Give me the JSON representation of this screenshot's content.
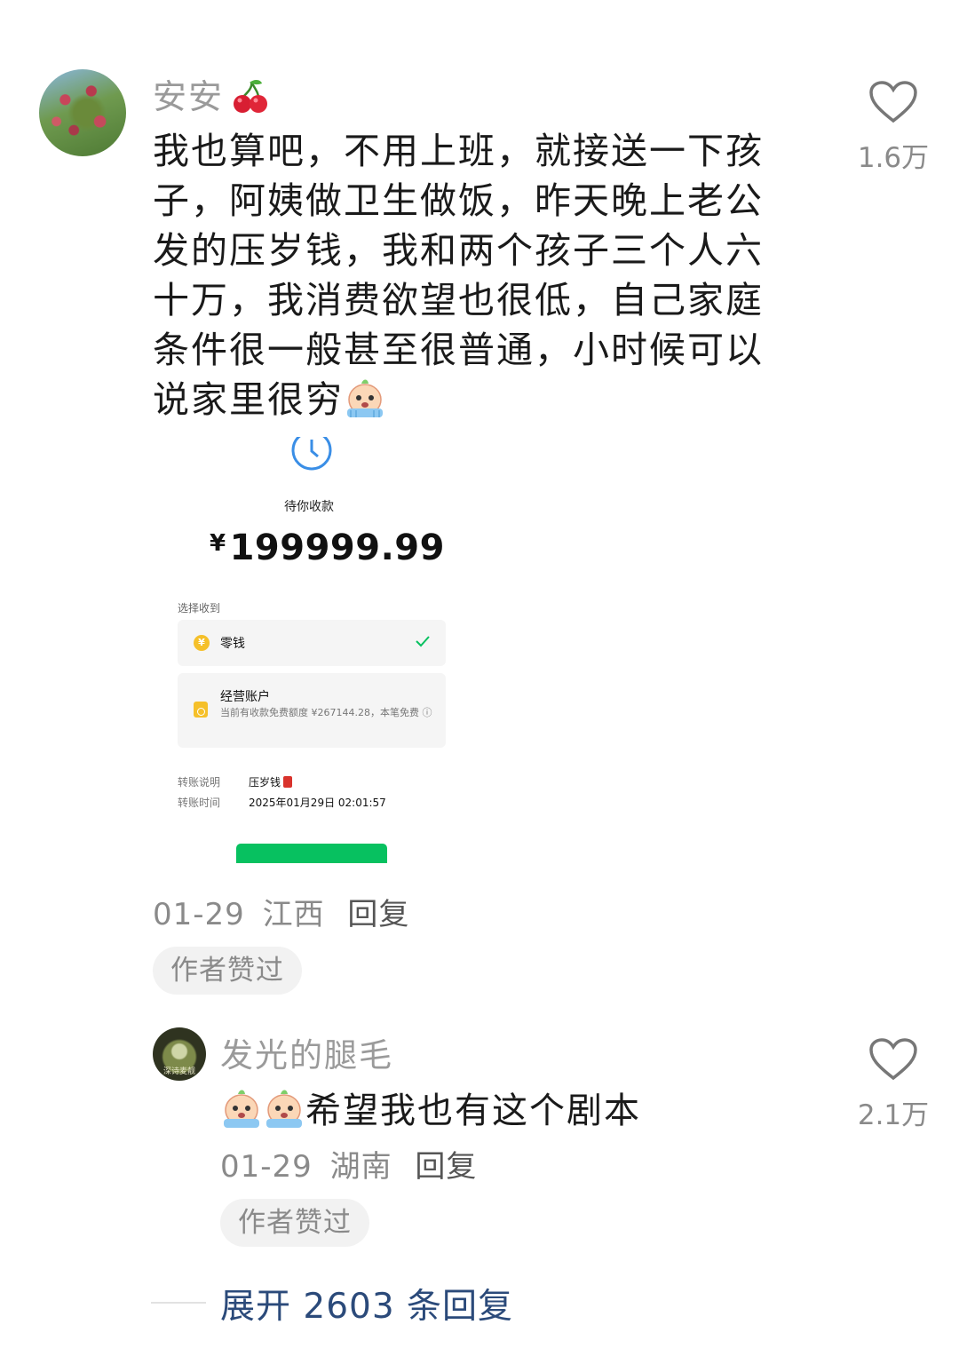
{
  "comment": {
    "username": "安安",
    "text": "我也算吧，不用上班，就接送一下孩子，阿姨做卫生做饭，昨天晚上老公发的压岁钱，我和两个孩子三个人六十万，我消费欲望也很低，自己家庭条件很一般甚至很普通，小时候可以说家里很穷",
    "meta_date": "01-29",
    "meta_location": "江西",
    "reply_label": "回复",
    "author_liked": "作者赞过",
    "like_count": "1.6万"
  },
  "screenshot": {
    "pending_label": "待你收款",
    "currency": "¥",
    "amount": "199999.99",
    "choose_label": "选择收到",
    "option1_icon": "¥",
    "option1": "零钱",
    "option2": "经营账户",
    "option2_desc": "当前有收款免费额度 ¥267144.28，本笔免费 ⓘ",
    "memo_label": "转账说明",
    "memo_value": "压岁钱",
    "time_label": "转账时间",
    "time_value": "2025年01月29日 02:01:57",
    "accent_color": "#07c160"
  },
  "reply": {
    "username": "发光的腿毛",
    "avatar_text": "深诗麦靓",
    "text": "希望我也有这个剧本",
    "meta_date": "01-29",
    "meta_location": "湖南",
    "reply_label": "回复",
    "author_liked": "作者赞过",
    "like_count": "2.1万"
  },
  "expand": {
    "label": "展开 2603 条回复"
  },
  "icons": [
    "heart-icon",
    "cherry-emoji",
    "crying-emoji",
    "clock-icon",
    "check-icon",
    "coin-icon"
  ]
}
